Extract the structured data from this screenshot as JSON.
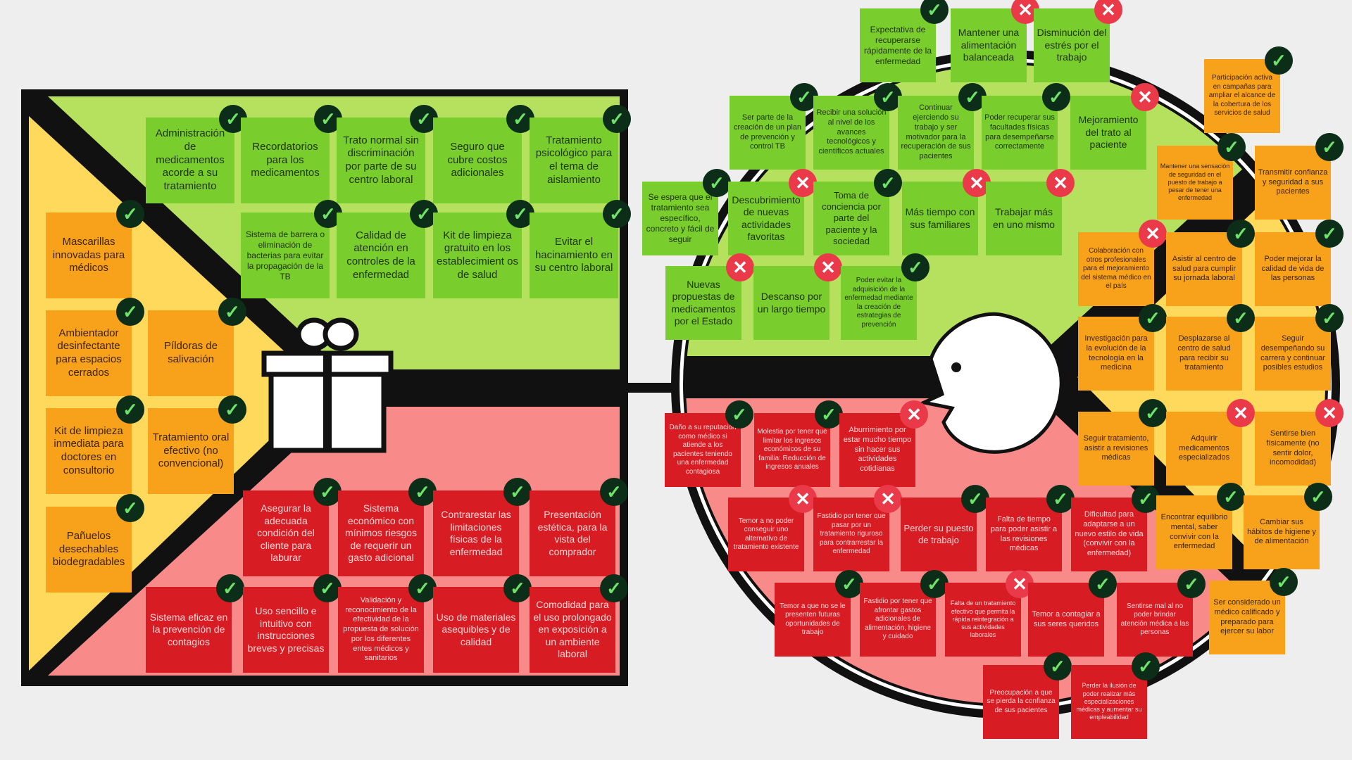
{
  "colors": {
    "green_note": "#79cd2d",
    "orange_note": "#f8a21c",
    "red_note": "#d81c24",
    "gains_panel": "#b6e15e",
    "pains_panel": "#f98a8a",
    "products_panel": "#fed95c",
    "check_badge": "#0c2d17",
    "cross_badge": "#ea3a4a"
  },
  "icons": {
    "check": "✓",
    "cross": "✕",
    "product": "gift-icon",
    "customer": "face-icon"
  },
  "value_map": {
    "gain_creators": [
      {
        "text": "Administración de medicamentos acorde a su tratamiento",
        "status": "check"
      },
      {
        "text": "Recordatorios para los medicamentos",
        "status": "check"
      },
      {
        "text": "Trato normal sin discriminación por parte de su centro laboral",
        "status": "check"
      },
      {
        "text": "Seguro que cubre costos adicionales",
        "status": "check"
      },
      {
        "text": "Tratamiento psicológico para el tema de aislamiento",
        "status": "check"
      },
      {
        "text": "Sistema de barrera o eliminación de bacterias para evitar la propagación de la TB",
        "status": "check"
      },
      {
        "text": "Calidad de atención en controles de la enfermedad",
        "status": "check"
      },
      {
        "text": "Kit de limpieza gratuito en los establecimient os de salud",
        "status": "check"
      },
      {
        "text": "Evitar el hacinamiento en su centro laboral",
        "status": "check"
      }
    ],
    "products": [
      {
        "text": "Mascarillas innovadas para médicos",
        "status": "check"
      },
      {
        "text": "Ambientador desinfectante para espacios cerrados",
        "status": "check"
      },
      {
        "text": "Píldoras de salivación",
        "status": "check"
      },
      {
        "text": "Kit de limpieza inmediata para doctores en consultorio",
        "status": "check"
      },
      {
        "text": "Tratamiento oral efectivo (no convencional)",
        "status": "check"
      },
      {
        "text": "Pañuelos desechables biodegradables",
        "status": "check"
      }
    ],
    "pain_relievers": [
      {
        "text": "Asegurar la adecuada condición del cliente para laburar",
        "status": "check"
      },
      {
        "text": "Sistema económico con mínimos riesgos de requerir un gasto adicional",
        "status": "check"
      },
      {
        "text": "Contrarestar las limitaciones físicas de la enfermedad",
        "status": "check"
      },
      {
        "text": "Presentación estética, para la vista del comprador",
        "status": "check"
      },
      {
        "text": "Sistema eficaz en la prevención de contagios",
        "status": "check"
      },
      {
        "text": "Uso sencillo e intuitivo con instrucciones breves y precisas",
        "status": "check"
      },
      {
        "text": "Validación y reconocimiento de la efectividad de la propuesta de solución por los diferentes entes médicos y sanitarios",
        "status": "check"
      },
      {
        "text": "Uso de materiales asequibles y de calidad",
        "status": "check"
      },
      {
        "text": "Comodidad para el uso prolongado en exposición a un ambiente laboral",
        "status": "check"
      }
    ]
  },
  "customer_profile": {
    "gains": [
      {
        "text": "Expectativa de recuperarse rápidamente de la enfermedad",
        "status": "check"
      },
      {
        "text": "Mantener una alimentación balanceada",
        "status": "cross"
      },
      {
        "text": "Disminución del estrés por el trabajo",
        "status": "cross"
      },
      {
        "text": "Ser parte de la creación de un plan de prevención y control TB",
        "status": "check"
      },
      {
        "text": "Recibir una solución al nivel de los avances tecnológicos y científicos actuales",
        "status": "check"
      },
      {
        "text": "Continuar ejerciendo su trabajo y ser motivador para la recuperación de sus pacientes",
        "status": "check"
      },
      {
        "text": "Poder recuperar sus facultades físicas para desempeñarse correctamente",
        "status": "check"
      },
      {
        "text": "Mejoramiento del trato al paciente",
        "status": "cross"
      },
      {
        "text": "Se espera que el tratamiento sea específico, concreto y fácil de seguir",
        "status": "check"
      },
      {
        "text": "Descubrimiento de nuevas actividades favoritas",
        "status": "cross"
      },
      {
        "text": "Toma de conciencia por parte del paciente y la sociedad",
        "status": "check"
      },
      {
        "text": "Más tiempo con sus familiares",
        "status": "cross"
      },
      {
        "text": "Trabajar más en uno mismo",
        "status": "cross"
      },
      {
        "text": "Nuevas propuestas de medicamentos por el Estado",
        "status": "cross"
      },
      {
        "text": "Descanso por un largo tiempo",
        "status": "cross"
      },
      {
        "text": "Poder evitar la adquisición de la enfermedad mediante la creación de estrategias de prevención",
        "status": "check"
      }
    ],
    "pains": [
      {
        "text": "Daño a su reputación como médico si atiende a los pacientes teniendo una enfermedad contagiosa",
        "status": "check"
      },
      {
        "text": "Molestia por tener que limitar los ingresos económicos de su familia: Reducción de ingresos anuales",
        "status": "check"
      },
      {
        "text": "Aburrimiento por estar mucho tiempo sin hacer sus actividades cotidianas",
        "status": "cross"
      },
      {
        "text": "Temor a no poder conseguir uno alternativo de tratamiento existente",
        "status": "cross"
      },
      {
        "text": "Fastidio por tener que pasar por un tratamiento riguroso para contrarrestar la enfermedad",
        "status": "cross"
      },
      {
        "text": "Perder su puesto de trabajo",
        "status": "check"
      },
      {
        "text": "Falta de tiempo para poder asistir a las revisiones médicas",
        "status": "check"
      },
      {
        "text": "Dificultad para adaptarse a un nuevo estilo de vida (convivir con la enfermedad)",
        "status": "check"
      },
      {
        "text": "Temor a que no se le presenten futuras oportunidades de trabajo",
        "status": "check"
      },
      {
        "text": "Fastidio por tener que afrontar gastos adicionales de alimentación, higiene y cuidado",
        "status": "check"
      },
      {
        "text": "Falta de un tratamiento efectivo que permita la rápida reintegración a sus actividades laborales",
        "status": "cross"
      },
      {
        "text": "Temor a contagiar a sus seres queridos",
        "status": "check"
      },
      {
        "text": "Sentirse mal al no poder brindar atención médica a las personas",
        "status": "check"
      },
      {
        "text": "Preocupación a que se pierda la confianza de sus pacientes",
        "status": "check"
      },
      {
        "text": "Perder la ilusión de poder realizar más especializaciones médicas y aumentar su empleabilidad",
        "status": "check"
      }
    ],
    "jobs": [
      {
        "text": "Participación activa en campañas para ampliar el alcance de la cobertura de los servicios de salud",
        "status": "check"
      },
      {
        "text": "Mantener una sensación de seguridad en el puesto de trabajo a pesar de tener una enfermedad",
        "status": "check"
      },
      {
        "text": "Transmitir confianza y seguridad a sus pacientes",
        "status": "check"
      },
      {
        "text": "Colaboración con otros profesionales para el mejoramiento del sistema médico en el país",
        "status": "cross"
      },
      {
        "text": "Asistir al centro de salud para cumplir su jornada laboral",
        "status": "check"
      },
      {
        "text": "Poder mejorar la calidad de vida de las personas",
        "status": "check"
      },
      {
        "text": "Investigación para la evolución de la tecnología en la medicina",
        "status": "check"
      },
      {
        "text": "Desplazarse al centro de salud para recibir su tratamiento",
        "status": "check"
      },
      {
        "text": "Seguir desempeñando su carrera y continuar posibles estudios",
        "status": "check"
      },
      {
        "text": "Seguir tratamiento, asistir a revisiones médicas",
        "status": "check"
      },
      {
        "text": "Adquirir medicamentos especializados",
        "status": "cross"
      },
      {
        "text": "Sentirse bien físicamente (no sentir dolor, incomodidad)",
        "status": "cross"
      },
      {
        "text": "Encontrar equilibrio mental, saber convivir con la enfermedad",
        "status": "check"
      },
      {
        "text": "Cambiar sus hábitos de higiene y de alimentación",
        "status": "check"
      },
      {
        "text": "Ser considerado un médico calificado y preparado para ejercer su labor",
        "status": "check"
      }
    ]
  }
}
